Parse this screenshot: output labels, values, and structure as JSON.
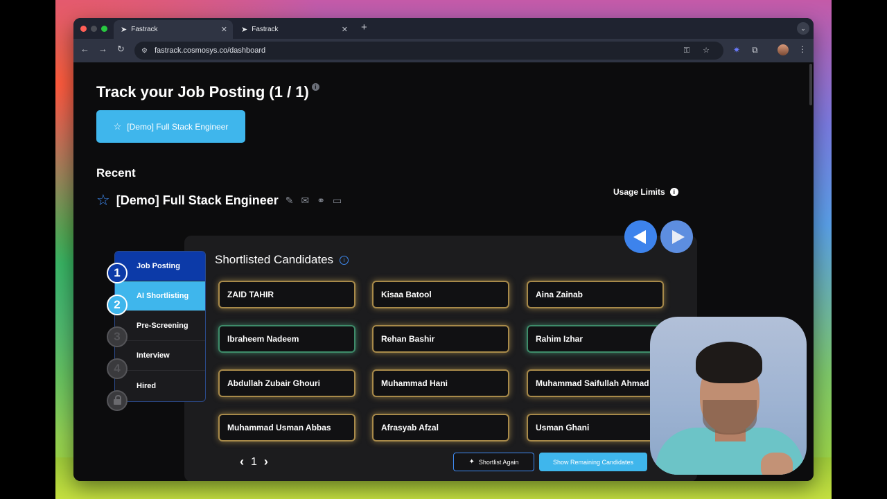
{
  "browser": {
    "tabs": [
      {
        "title": "Fastrack",
        "active": true
      },
      {
        "title": "Fastrack",
        "active": false
      }
    ],
    "url": "fastrack.cosmosys.co/dashboard"
  },
  "page": {
    "title": "Track your Job Posting (1 / 1)",
    "job_button_label": "[Demo] Full Stack Engineer",
    "recent_heading": "Recent",
    "recent_job_name": "[Demo] Full Stack Engineer",
    "usage_limits_label": "Usage Limits"
  },
  "steps": [
    {
      "number": "1",
      "label": "Job Posting",
      "state": "done"
    },
    {
      "number": "2",
      "label": "AI Shortlisting",
      "state": "current"
    },
    {
      "number": "3",
      "label": "Pre-Screening",
      "state": "pending"
    },
    {
      "number": "4",
      "label": "Interview",
      "state": "pending"
    },
    {
      "number": "",
      "label": "Hired",
      "state": "locked"
    }
  ],
  "shortlist": {
    "title": "Shortlisted Candidates",
    "candidates": [
      {
        "name": "ZAID TAHIR",
        "glow": "gold"
      },
      {
        "name": "Kisaa Batool",
        "glow": "gold"
      },
      {
        "name": "Aina Zainab",
        "glow": "gold"
      },
      {
        "name": "Ibraheem Nadeem",
        "glow": "green"
      },
      {
        "name": "Rehan Bashir",
        "glow": "gold"
      },
      {
        "name": "Rahim Izhar",
        "glow": "green"
      },
      {
        "name": "Abdullah Zubair Ghouri",
        "glow": "gold"
      },
      {
        "name": "Muhammad Hani",
        "glow": "gold"
      },
      {
        "name": "Muhammad Saifullah Ahmad",
        "glow": "gold"
      },
      {
        "name": "Muhammad Usman Abbas",
        "glow": "gold"
      },
      {
        "name": "Afrasyab Afzal",
        "glow": "gold"
      },
      {
        "name": "Usman Ghani",
        "glow": "gold"
      }
    ],
    "page_number": "1",
    "shortlist_again_label": "Shortlist Again",
    "show_remaining_label": "Show Remaining Candidates"
  },
  "colors": {
    "accent": "#3fb6ec",
    "primary_blue": "#0c3aa8",
    "gold_glow": "#a88a4a",
    "green_glow": "#3e8c6a"
  }
}
